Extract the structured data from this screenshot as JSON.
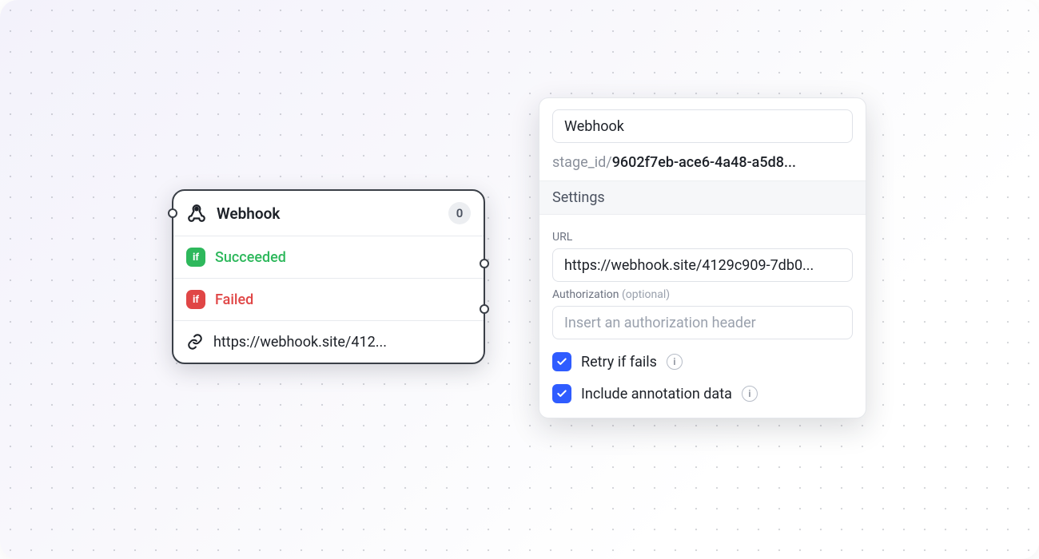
{
  "node": {
    "title": "Webhook",
    "count": "0",
    "branches": [
      {
        "badge": "if",
        "label": "Succeeded",
        "color": "green"
      },
      {
        "badge": "if",
        "label": "Failed",
        "color": "red"
      }
    ],
    "url_display": "https://webhook.site/412..."
  },
  "panel": {
    "name_value": "Webhook",
    "stage_key": "stage_id/",
    "stage_val": "9602f7eb-ace6-4a48-a5d8...",
    "settings_header": "Settings",
    "url_label": "URL",
    "url_value": "https://webhook.site/4129c909-7db0...",
    "auth_label": "Authorization ",
    "auth_optional": "(optional)",
    "auth_placeholder": "Insert an authorization header",
    "retry_label": "Retry if fails",
    "retry_checked": true,
    "include_label": "Include annotation data",
    "include_checked": true
  }
}
